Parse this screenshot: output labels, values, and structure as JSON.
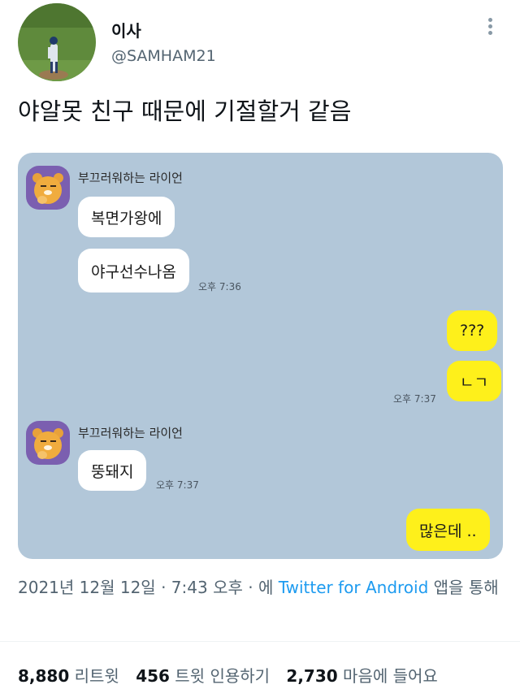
{
  "tweet": {
    "display_name": "이사",
    "handle": "@SAMHAM21",
    "text": "야알못 친구 때문에 기절할거 같음",
    "more_icon": "more-vertical-icon"
  },
  "chat": {
    "colors": {
      "background": "#b2c7d9",
      "my_bubble": "#fef01b",
      "their_bubble": "#ffffff"
    },
    "sender_name": "부끄러워하는 라이언",
    "messages": [
      {
        "from": "them",
        "text": "복면가왕에"
      },
      {
        "from": "them",
        "text": "야구선수나옴",
        "time": "오후 7:36"
      },
      {
        "from": "me",
        "text": "???"
      },
      {
        "from": "me",
        "text": "ㄴㄱ",
        "time": "오후 7:37"
      },
      {
        "from": "them",
        "text": "뚱돼지",
        "time": "오후 7:37"
      },
      {
        "from": "me",
        "text": "많은데 .."
      }
    ]
  },
  "meta": {
    "date": "2021년 12월 12일",
    "time": "7:43 오후",
    "via_prefix": "에",
    "source": "Twitter for Android",
    "via_suffix": "앱을 통해"
  },
  "stats": {
    "retweets_count": "8,880",
    "retweets_label": "리트윗",
    "quotes_count": "456",
    "quotes_label": "트윗 인용하기",
    "likes_count": "2,730",
    "likes_label": "마음에 들어요"
  }
}
